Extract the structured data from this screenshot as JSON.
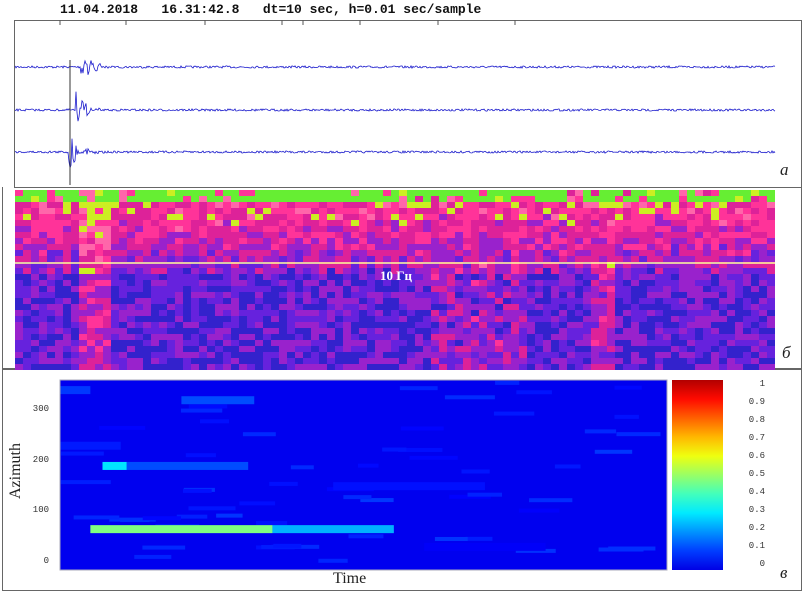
{
  "header": {
    "date": "11.04.2018",
    "time": "16.31:42.8",
    "params": "dt=10 sec, h=0.01 sec/sample"
  },
  "panels": {
    "a": "а",
    "b": "б",
    "c": "в"
  },
  "chart_data": [
    {
      "type": "line",
      "name_label": "",
      "traces": 3,
      "trace_color": "#1a1acc",
      "event": "impulsive arrival near start of window on all 3 traces",
      "time_ticks_top": 7
    },
    {
      "type": "heatmap",
      "annotation": "10 Гц",
      "colormap": "magenta-pink-yellow-green on blue",
      "reference_line_color": "#ffff99"
    },
    {
      "type": "heatmap",
      "xlabel": "Time",
      "ylabel": "Azimuth",
      "ylim": [
        0,
        360
      ],
      "yticks": [
        "0",
        "100",
        "200",
        "300"
      ],
      "colorbar": {
        "ticks": [
          "0",
          "0.1",
          "0.2",
          "0.3",
          "0.4",
          "0.5",
          "0.6",
          "0.7",
          "0.8",
          "0.9",
          "1"
        ],
        "range": [
          0,
          1
        ],
        "colormap": "jet"
      },
      "time_range_percent": [
        0,
        100
      ],
      "bands": [
        {
          "azimuth": 65,
          "time_start": 5,
          "time_end": 35,
          "value": 0.5
        },
        {
          "azimuth": 65,
          "time_start": 35,
          "time_end": 55,
          "value": 0.3
        },
        {
          "azimuth": 190,
          "time_start": 7,
          "time_end": 11,
          "value": 0.35
        },
        {
          "azimuth": 190,
          "time_start": 11,
          "time_end": 31,
          "value": 0.2
        },
        {
          "azimuth": 320,
          "time_start": 20,
          "time_end": 32,
          "value": 0.2
        },
        {
          "azimuth": 340,
          "time_start": 0,
          "time_end": 5,
          "value": 0.18
        },
        {
          "azimuth": 230,
          "time_start": 0,
          "time_end": 10,
          "value": 0.15
        },
        {
          "azimuth": 150,
          "time_start": 45,
          "time_end": 70,
          "value": 0.14
        },
        {
          "azimuth": 30,
          "time_start": 60,
          "time_end": 80,
          "value": 0.12
        }
      ]
    }
  ]
}
